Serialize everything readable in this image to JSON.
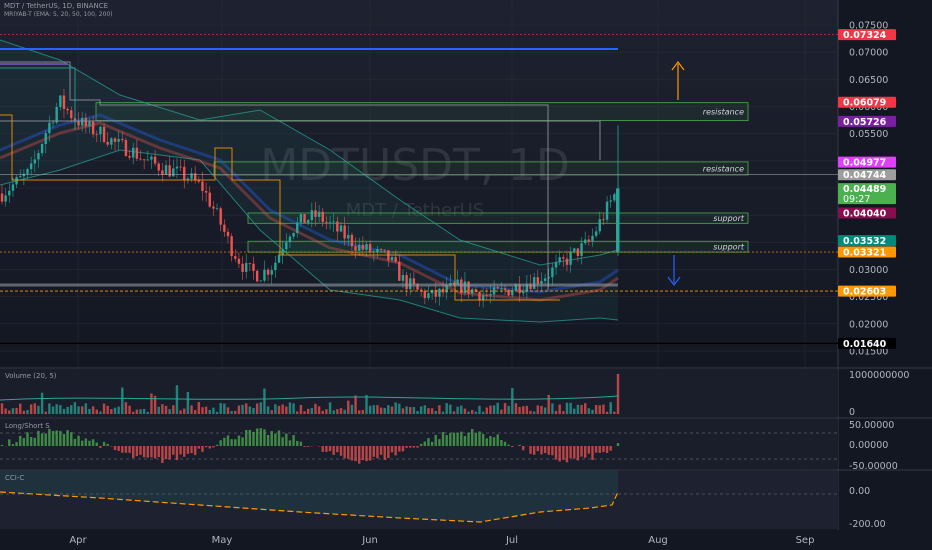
{
  "header": {
    "symbol_line": "MDT / TetherUS, 1D, BINANCE",
    "indicator_line": "MRIYAB-T (EMA: 5, 20, 50, 100, 200)"
  },
  "watermark": {
    "ticker": "MDTUSDT, 1D",
    "name": "MDT / TetherUS"
  },
  "colors": {
    "background": "#131722",
    "up": "#26a69a",
    "down": "#ef5350",
    "zone_green": "#4caf50",
    "zone_orange": "#ff9800",
    "blue_line": "#2962ff"
  },
  "chart_data": {
    "type": "candlestick",
    "x_ticks": [
      "Apr",
      "May",
      "Jun",
      "Jul",
      "Aug",
      "Sep"
    ],
    "y_ticks": [
      "0.07500",
      "0.07000",
      "0.06500",
      "0.06000",
      "0.05500",
      "0.05000",
      "0.04500",
      "0.04000",
      "0.03500",
      "0.03000",
      "0.02500",
      "0.02000",
      "0.01500"
    ],
    "ylim": [
      0.013,
      0.078
    ],
    "close_path": [
      0.044,
      0.046,
      0.048,
      0.055,
      0.061,
      0.058,
      0.056,
      0.055,
      0.053,
      0.052,
      0.05,
      0.049,
      0.048,
      0.047,
      0.045,
      0.04,
      0.034,
      0.03,
      0.029,
      0.031,
      0.037,
      0.039,
      0.04,
      0.038,
      0.036,
      0.034,
      0.033,
      0.032,
      0.028,
      0.026,
      0.025,
      0.026,
      0.027,
      0.026,
      0.025,
      0.026,
      0.027,
      0.028,
      0.029,
      0.031,
      0.033,
      0.035,
      0.04,
      0.0449
    ],
    "price_labels": [
      {
        "value": "0.07324",
        "price": 0.07324,
        "color": "#f23645"
      },
      {
        "value": "0.06079",
        "price": 0.06079,
        "color": "#f23645"
      },
      {
        "value": "0.05726",
        "price": 0.05726,
        "color": "#7b1fa2"
      },
      {
        "value": "0.04977",
        "price": 0.04977,
        "color": "#e040fb"
      },
      {
        "value": "0.04744",
        "price": 0.04744,
        "color": "#9e9e9e"
      },
      {
        "value": "0.04489",
        "price": 0.04489,
        "color": "#4caf50"
      },
      {
        "value": "0.04040",
        "price": 0.0404,
        "color": "#880e4f"
      },
      {
        "value": "0.03532",
        "price": 0.03532,
        "color": "#00897b"
      },
      {
        "value": "0.03321",
        "price": 0.03321,
        "color": "#ff9800"
      },
      {
        "value": "0.02603",
        "price": 0.02603,
        "color": "#ff9800"
      },
      {
        "value": "0.01640",
        "price": 0.0164,
        "color": "#000000"
      }
    ],
    "countdown": "09:27",
    "zones": [
      {
        "label": "resistance",
        "top": 0.0607,
        "bottom": 0.0574
      },
      {
        "label": "resistance",
        "top": 0.0498,
        "bottom": 0.0474
      },
      {
        "label": "support",
        "top": 0.0404,
        "bottom": 0.0385
      },
      {
        "label": "support",
        "top": 0.0352,
        "bottom": 0.0332
      }
    ],
    "panes": [
      {
        "name": "Volume (20, 5)",
        "ticks": [
          "1000000000",
          "0"
        ]
      },
      {
        "name": "Long/Short S",
        "ticks": [
          "50.00000",
          "0.00000",
          "-50.00000"
        ]
      },
      {
        "name": "CCI-C",
        "ticks": [
          "0.00",
          "-200.00"
        ]
      }
    ]
  }
}
